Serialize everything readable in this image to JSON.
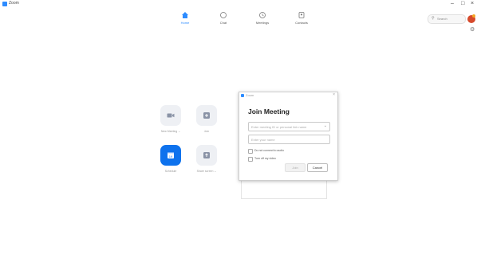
{
  "window": {
    "title": "Zoom",
    "controls": [
      "–",
      "□",
      "×"
    ]
  },
  "nav": [
    {
      "label": "Home",
      "icon": "home-icon",
      "active": true
    },
    {
      "label": "Chat",
      "icon": "chat-icon",
      "active": false
    },
    {
      "label": "Meetings",
      "icon": "clock-icon",
      "active": false
    },
    {
      "label": "Contacts",
      "icon": "contacts-icon",
      "active": false
    }
  ],
  "search": {
    "label": "Search"
  },
  "home": {
    "tiles": [
      {
        "label": "New Meeting ⌄",
        "icon": "video-camera-icon",
        "color": "#eef0f4"
      },
      {
        "label": "Join",
        "icon": "plus-icon",
        "color": "#eef0f4"
      },
      {
        "label": "Schedule",
        "icon": "calendar-icon",
        "color": "#0e72ed"
      },
      {
        "label": "Share screen ⌄",
        "icon": "share-screen-icon",
        "color": "#eef0f4"
      }
    ]
  },
  "dialog": {
    "window_title": "Zoom",
    "heading": "Join Meeting",
    "id_placeholder": "Enter meeting ID or personal link name",
    "name_placeholder": "Enter your name",
    "options": [
      "Do not connect to audio",
      "Turn off my video"
    ],
    "join_label": "Join",
    "cancel_label": "Cancel"
  },
  "colors": {
    "accent": "#2d8cff",
    "schedule_tile": "#0e72ed",
    "avatar": "#d64a2c"
  }
}
